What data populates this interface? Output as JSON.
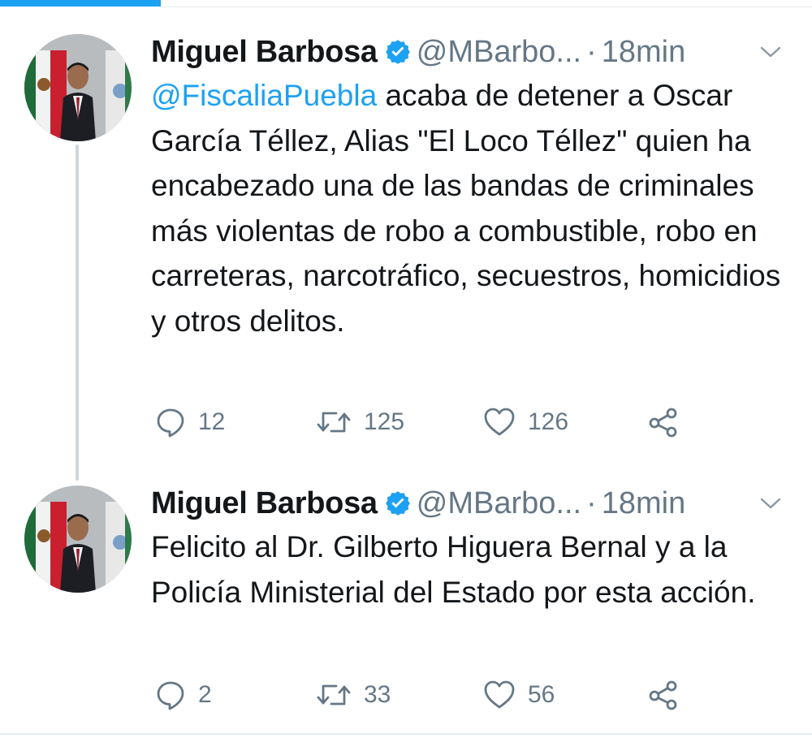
{
  "colors": {
    "accent": "#1da1f2",
    "text": "#14171a",
    "secondary": "#657786",
    "divider": "#e6ecf0"
  },
  "tweets": [
    {
      "author_name": "Miguel Barbosa",
      "handle": "@MBarbo...",
      "separator": "·",
      "time": "18min",
      "mention": "@FiscaliaPuebla",
      "text": " acaba de detener a Oscar García Téllez, Alias \"El Loco Téllez\" quien ha encabezado una de las bandas de criminales más violentas de robo a combustible, robo en carreteras, narcotráfico, secuestros, homicidios y otros delitos.",
      "replies": "12",
      "retweets": "125",
      "likes": "126",
      "icons": {
        "reply": "reply-icon",
        "retweet": "retweet-icon",
        "like": "heart-icon",
        "share": "share-icon",
        "verified": "verified-badge-icon",
        "menu": "chevron-down-icon"
      }
    },
    {
      "author_name": "Miguel Barbosa",
      "handle": "@MBarbo...",
      "separator": "·",
      "time": "18min",
      "text": "Felicito al Dr. Gilberto Higuera Bernal y a la Policía Ministerial del Estado por esta acción.",
      "replies": "2",
      "retweets": "33",
      "likes": "56",
      "icons": {
        "reply": "reply-icon",
        "retweet": "retweet-icon",
        "like": "heart-icon",
        "share": "share-icon",
        "verified": "verified-badge-icon",
        "menu": "chevron-down-icon"
      }
    }
  ]
}
